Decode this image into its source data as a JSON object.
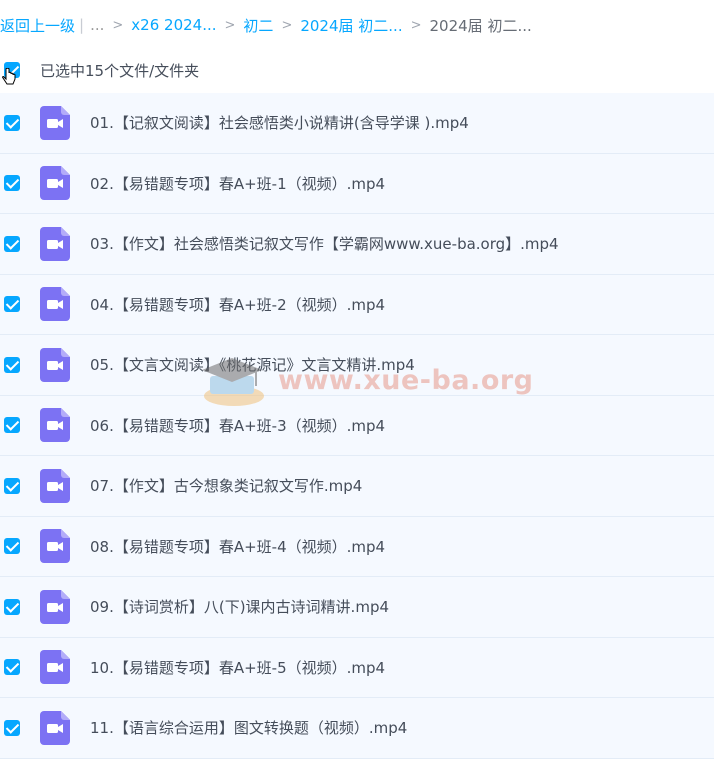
{
  "breadcrumb": {
    "back": "返回上一级",
    "ellipsis": "...",
    "items": [
      "x26 2024...",
      "初二",
      "2024届 初二..."
    ],
    "current": "2024届 初二..."
  },
  "selection": {
    "text": "已选中15个文件/文件夹"
  },
  "files": [
    "01.【记叙文阅读】社会感悟类小说精讲(含导学课 ).mp4",
    "02.【易错题专项】春A+班-1（视频）.mp4",
    "03.【作文】社会感悟类记叙文写作【学霸网www.xue-ba.org】.mp4",
    "04.【易错题专项】春A+班-2（视频）.mp4",
    "05.【文言文阅读】《桃花源记》文言文精讲.mp4",
    "06.【易错题专项】春A+班-3（视频）.mp4",
    "07.【作文】古今想象类记叙文写作.mp4",
    "08.【易错题专项】春A+班-4（视频）.mp4",
    "09.【诗词赏析】八(下)课内古诗词精讲.mp4",
    "10.【易错题专项】春A+班-5（视频）.mp4",
    "11.【语言综合运用】图文转换题（视频）.mp4"
  ],
  "watermark": {
    "text": "www.xue-ba.org"
  },
  "colors": {
    "accent": "#06a7ff",
    "video_icon": "#7c72f3",
    "row_bg": "#f5f9ff"
  },
  "icons": {
    "file": "video-file-icon",
    "checkbox": "checkbox-checked-icon"
  }
}
